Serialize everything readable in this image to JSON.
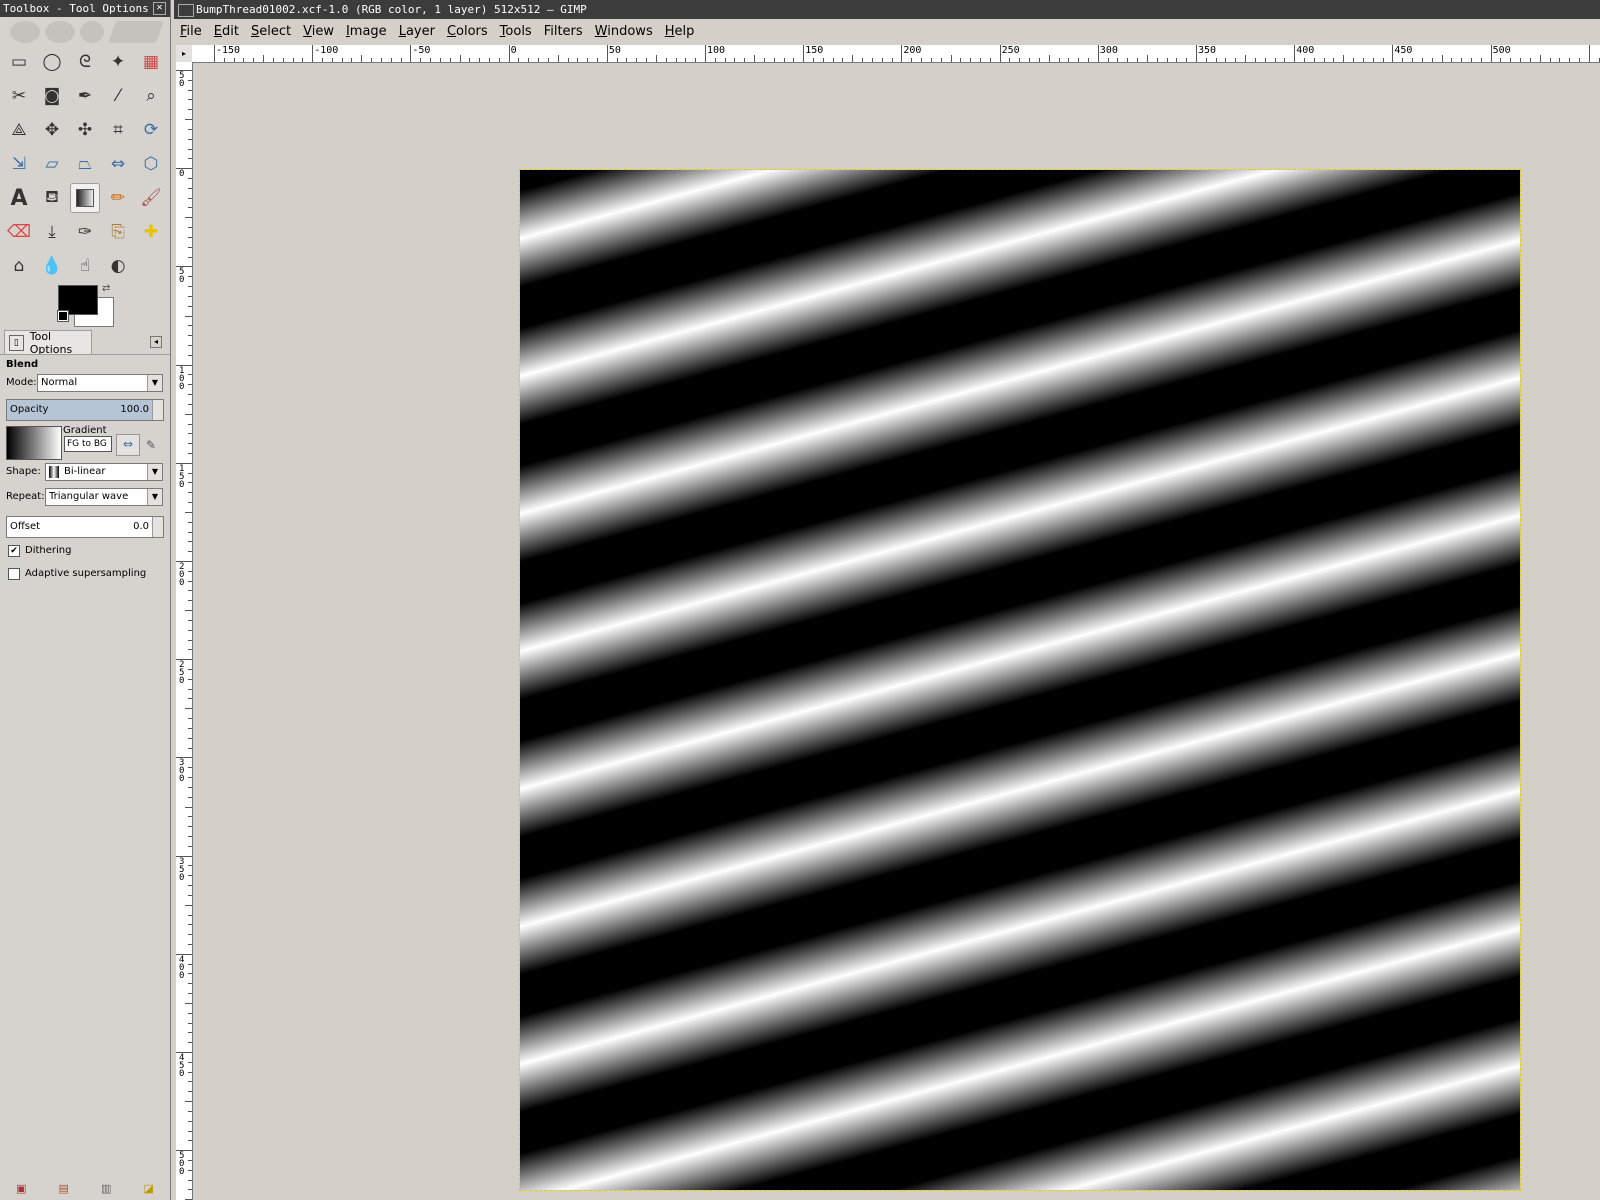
{
  "toolbox": {
    "title": "Toolbox - Tool Options",
    "close_glyph": "✕",
    "tools": [
      {
        "name": "rect-select-icon",
        "active": false
      },
      {
        "name": "ellipse-select-icon",
        "active": false
      },
      {
        "name": "free-select-icon",
        "active": false
      },
      {
        "name": "fuzzy-select-icon",
        "active": false
      },
      {
        "name": "select-by-color-icon",
        "active": false
      },
      {
        "name": "scissors-icon",
        "active": false
      },
      {
        "name": "foreground-select-icon",
        "active": false
      },
      {
        "name": "paths-icon",
        "active": false
      },
      {
        "name": "color-picker-icon",
        "active": false
      },
      {
        "name": "zoom-icon",
        "active": false
      },
      {
        "name": "measure-icon",
        "active": false
      },
      {
        "name": "move-icon",
        "active": false
      },
      {
        "name": "align-icon",
        "active": false
      },
      {
        "name": "crop-icon",
        "active": false
      },
      {
        "name": "rotate-icon",
        "active": false
      },
      {
        "name": "scale-icon",
        "active": false
      },
      {
        "name": "shear-icon",
        "active": false
      },
      {
        "name": "perspective-icon",
        "active": false
      },
      {
        "name": "flip-icon",
        "active": false
      },
      {
        "name": "cage-icon",
        "active": false
      },
      {
        "name": "text-icon",
        "active": false
      },
      {
        "name": "bucket-fill-icon",
        "active": false
      },
      {
        "name": "blend-icon",
        "active": true
      },
      {
        "name": "pencil-icon",
        "active": false
      },
      {
        "name": "paintbrush-icon",
        "active": false
      },
      {
        "name": "eraser-icon",
        "active": false
      },
      {
        "name": "airbrush-icon",
        "active": false
      },
      {
        "name": "ink-icon",
        "active": false
      },
      {
        "name": "clone-icon",
        "active": false
      },
      {
        "name": "heal-icon",
        "active": false
      },
      {
        "name": "perspective-clone-icon",
        "active": false
      },
      {
        "name": "blur-icon",
        "active": false
      },
      {
        "name": "smudge-icon",
        "active": false
      },
      {
        "name": "dodge-burn-icon",
        "active": false
      }
    ],
    "fg_color": "#000000",
    "bg_color": "#ffffff"
  },
  "tool_options": {
    "tab_label": "Tool Options",
    "tool_name": "Blend",
    "mode_label": "Mode:",
    "mode_value": "Normal",
    "opacity_label": "Opacity",
    "opacity_value": "100.0",
    "opacity_fraction": 0.96,
    "gradient_label": "Gradient",
    "gradient_value": "FG to BG",
    "shape_label": "Shape:",
    "shape_value": "Bi-linear",
    "repeat_label": "Repeat:",
    "repeat_value": "Triangular wave",
    "offset_label": "Offset",
    "offset_value": "0.0",
    "dithering_label": "Dithering",
    "dithering_checked": true,
    "adaptive_label": "Adaptive supersampling",
    "adaptive_checked": false
  },
  "image_window": {
    "title": "BumpThread01002.xcf-1.0 (RGB color, 1 layer) 512x512 – GIMP",
    "menu": [
      {
        "key": "F",
        "rest": "ile"
      },
      {
        "key": "E",
        "rest": "dit"
      },
      {
        "key": "S",
        "rest": "elect"
      },
      {
        "key": "V",
        "rest": "iew"
      },
      {
        "key": "I",
        "rest": "mage"
      },
      {
        "key": "L",
        "rest": "ayer"
      },
      {
        "key": "C",
        "rest": "olors"
      },
      {
        "key": "T",
        "rest": "ools"
      },
      {
        "key": "",
        "rest": "Filters"
      },
      {
        "key": "W",
        "rest": "indows"
      },
      {
        "key": "H",
        "rest": "elp"
      }
    ],
    "hruler_labels": [
      "-150",
      "-100",
      "-50",
      "0",
      "50",
      "100",
      "150",
      "200",
      "250",
      "300",
      "350",
      "400",
      "450",
      "500"
    ],
    "vruler_labels": [
      "50",
      "0",
      "50",
      "100",
      "150",
      "200",
      "250",
      "300",
      "350",
      "400",
      "450",
      "500"
    ]
  }
}
